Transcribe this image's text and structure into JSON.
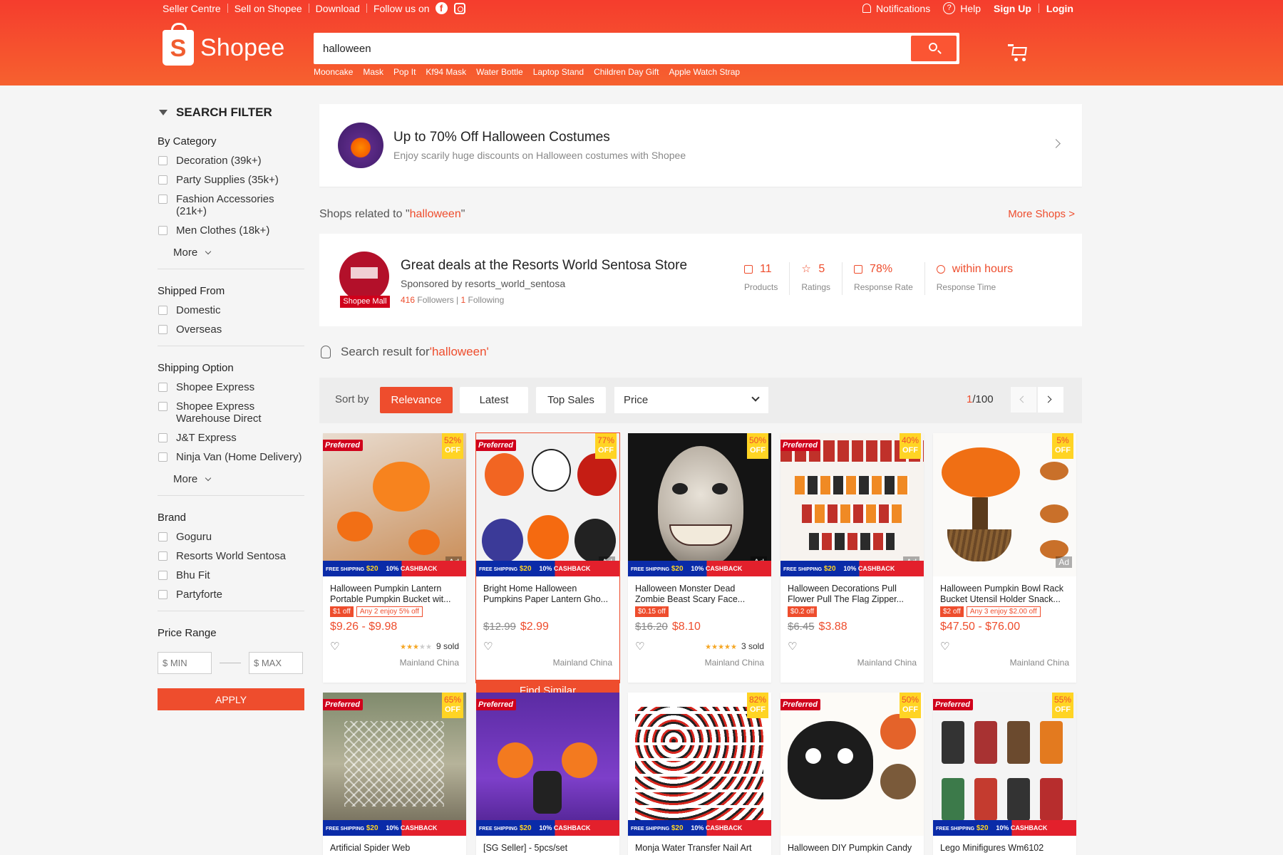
{
  "topnav": {
    "seller_centre": "Seller Centre",
    "sell_on_shopee": "Sell on Shopee",
    "download": "Download",
    "follow_us": "Follow us on",
    "notifications": "Notifications",
    "help": "Help",
    "sign_up": "Sign Up",
    "login": "Login"
  },
  "header": {
    "brand": "Shopee",
    "logo_letter": "S",
    "search_value": "halloween",
    "suggestions": [
      "Mooncake",
      "Mask",
      "Pop It",
      "Kf94 Mask",
      "Water Bottle",
      "Laptop Stand",
      "Children Day Gift",
      "Apple Watch Strap"
    ]
  },
  "sidebar": {
    "title": "SEARCH FILTER",
    "category": {
      "title": "By Category",
      "options": [
        "Decoration (39k+)",
        "Party Supplies (35k+)",
        "Fashion Accessories (21k+)",
        "Men Clothes (18k+)"
      ],
      "more": "More"
    },
    "shipped_from": {
      "title": "Shipped From",
      "options": [
        "Domestic",
        "Overseas"
      ]
    },
    "shipping_option": {
      "title": "Shipping Option",
      "options": [
        "Shopee Express",
        "Shopee Express Warehouse Direct",
        "J&T Express",
        "Ninja Van (Home Delivery)"
      ],
      "more": "More"
    },
    "brand": {
      "title": "Brand",
      "options": [
        "Goguru",
        "Resorts World Sentosa",
        "Bhu Fit",
        "Partyforte"
      ]
    },
    "price_range": {
      "title": "Price Range",
      "min_placeholder": "$ MIN",
      "max_placeholder": "$ MAX",
      "apply": "APPLY"
    }
  },
  "promo": {
    "title": "Up to 70% Off Halloween Costumes",
    "subtitle": "Enjoy scarily huge discounts on Halloween costumes with Shopee"
  },
  "related": {
    "prefix": "Shops related to \"",
    "query": "halloween",
    "suffix": "\"",
    "more_shops": "More Shops >"
  },
  "shop": {
    "name": "Great deals at the Resorts World Sentosa Store",
    "sponsored": "Sponsored by resorts_world_sentosa",
    "mall_badge": "Shopee Mall",
    "followers_count": "416",
    "followers_label": "Followers | ",
    "following_count": "1",
    "following_label": "Following",
    "stats": [
      {
        "value": "11",
        "label": "Products"
      },
      {
        "value": "5",
        "label": "Ratings"
      },
      {
        "value": "78%",
        "label": "Response Rate"
      },
      {
        "value": "within hours",
        "label": "Response Time"
      }
    ]
  },
  "search_result": {
    "prefix": "Search result for ",
    "query": "'halloween'"
  },
  "sort": {
    "label": "Sort by",
    "relevance": "Relevance",
    "latest": "Latest",
    "top_sales": "Top Sales",
    "price": "Price",
    "page_current": "1",
    "page_total": "/100"
  },
  "banner_text": {
    "free_shipping": "FREE SHIPPING",
    "voucher": "$20",
    "cashback": "10% CASHBACK",
    "preferred": "Preferred",
    "off": "OFF",
    "ad": "Ad",
    "find_similar": "Find Similar"
  },
  "products": [
    {
      "title": "Halloween Pumpkin Lantern Portable Pumpkin Bucket wit...",
      "discount": "52%",
      "tag1": "$1 off",
      "tag2": "Any 2 enjoy 5% off",
      "old_price": "",
      "price": "$9.26 - $9.98",
      "stars": 3,
      "sold": "9 sold",
      "location": "Mainland China",
      "preferred": true,
      "ad": true
    },
    {
      "title": "Bright Home Halloween Pumpkins Paper Lantern Gho...",
      "discount": "77%",
      "tag1": "",
      "tag2": "",
      "old_price": "$12.99",
      "price": "$2.99",
      "stars": 0,
      "sold": "",
      "location": "Mainland China",
      "preferred": true,
      "ad": true
    },
    {
      "title": "Halloween Monster Dead Zombie Beast Scary Face...",
      "discount": "50%",
      "tag1": "$0.15 off",
      "tag2": "",
      "old_price": "$16.20",
      "price": "$8.10",
      "stars": 5,
      "sold": "3 sold",
      "location": "Mainland China",
      "preferred": false,
      "ad": true
    },
    {
      "title": "Halloween Decorations Pull Flower Pull The Flag Zipper...",
      "discount": "40%",
      "tag1": "$0.2 off",
      "tag2": "",
      "old_price": "$6.45",
      "price": "$3.88",
      "stars": 0,
      "sold": "",
      "location": "Mainland China",
      "preferred": true,
      "ad": true
    },
    {
      "title": "Halloween Pumpkin Bowl Rack Bucket Utensil Holder Snack...",
      "discount": "5%",
      "tag1": "$2 off",
      "tag2": "Any 3 enjoy $2.00 off",
      "old_price": "",
      "price": "$47.50 - $76.00",
      "stars": 0,
      "sold": "",
      "location": "Mainland China",
      "preferred": false,
      "ad": true
    },
    {
      "title": "Artificial Spider Web",
      "discount": "65%",
      "preferred": true
    },
    {
      "title": "[SG Seller] - 5pcs/set",
      "discount": "",
      "preferred": true
    },
    {
      "title": "Monja Water Transfer Nail Art",
      "discount": "82%",
      "preferred": false
    },
    {
      "title": "Halloween DIY Pumpkin Candy",
      "discount": "50%",
      "preferred": true
    },
    {
      "title": "Lego Minifigures Wm6102",
      "discount": "55%",
      "preferred": true
    }
  ]
}
